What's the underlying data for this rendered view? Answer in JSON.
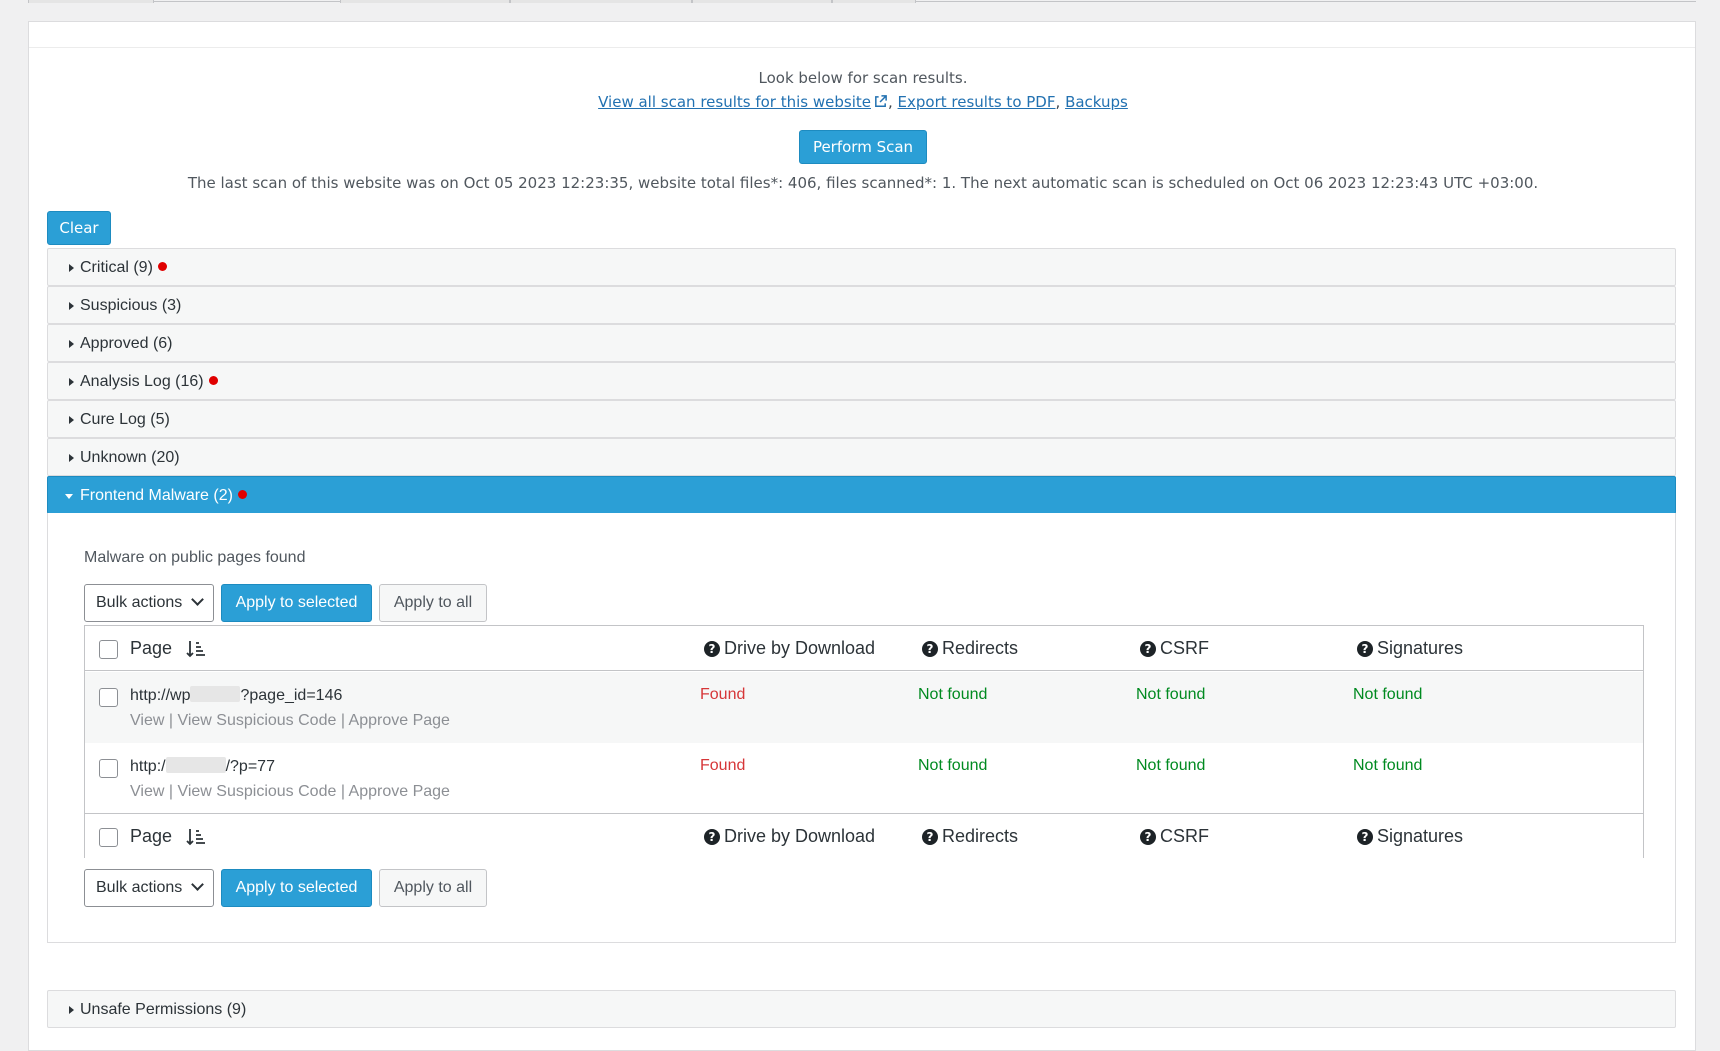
{
  "header": {
    "look_text": "Look below for scan results.",
    "link_view_all": "View all scan results for this website",
    "link_export": "Export results to PDF",
    "link_backups": "Backups",
    "separator": ",",
    "perform_scan_label": "Perform Scan",
    "last_scan_text": "The last scan of this website was on Oct 05 2023 12:23:35, website total files*: 406, files scanned*: 1. The next automatic scan is scheduled on Oct 06 2023 12:23:43 UTC +03:00."
  },
  "clear_label": "Clear",
  "sections": [
    {
      "label": "Critical (9)",
      "alert": true
    },
    {
      "label": "Suspicious (3)",
      "alert": false
    },
    {
      "label": "Approved (6)",
      "alert": false
    },
    {
      "label": "Analysis Log (16)",
      "alert": true
    },
    {
      "label": "Cure Log (5)",
      "alert": false
    },
    {
      "label": "Unknown (20)",
      "alert": false
    },
    {
      "label": "Frontend Malware (2)",
      "alert": true,
      "expanded": true
    },
    {
      "label": "Unsafe Permissions (9)",
      "alert": false
    }
  ],
  "frontend_malware": {
    "heading": "Malware on public pages found",
    "bulk_actions_label": "Bulk actions",
    "apply_selected_label": "Apply to selected",
    "apply_all_label": "Apply to all",
    "columns": {
      "page": "Page",
      "drive_by": "Drive by Download",
      "redirects": "Redirects",
      "csrf": "CSRF",
      "signatures": "Signatures"
    },
    "rows": [
      {
        "url_prefix": "http://wp",
        "url_suffix": "?page_id=146",
        "drive_by": "Found",
        "redirects": "Not found",
        "csrf": "Not found",
        "signatures": "Not found"
      },
      {
        "url_prefix": "http:/",
        "url_suffix": "/?p=77",
        "drive_by": "Found",
        "redirects": "Not found",
        "csrf": "Not found",
        "signatures": "Not found"
      }
    ],
    "row_actions": {
      "view": "View",
      "view_code": "View Suspicious Code",
      "approve": "Approve Page",
      "divider": "|"
    }
  },
  "colors": {
    "accent": "#2b9fd6",
    "found": "#d63638",
    "not_found": "#008a20",
    "alert_dot": "#e00000"
  }
}
